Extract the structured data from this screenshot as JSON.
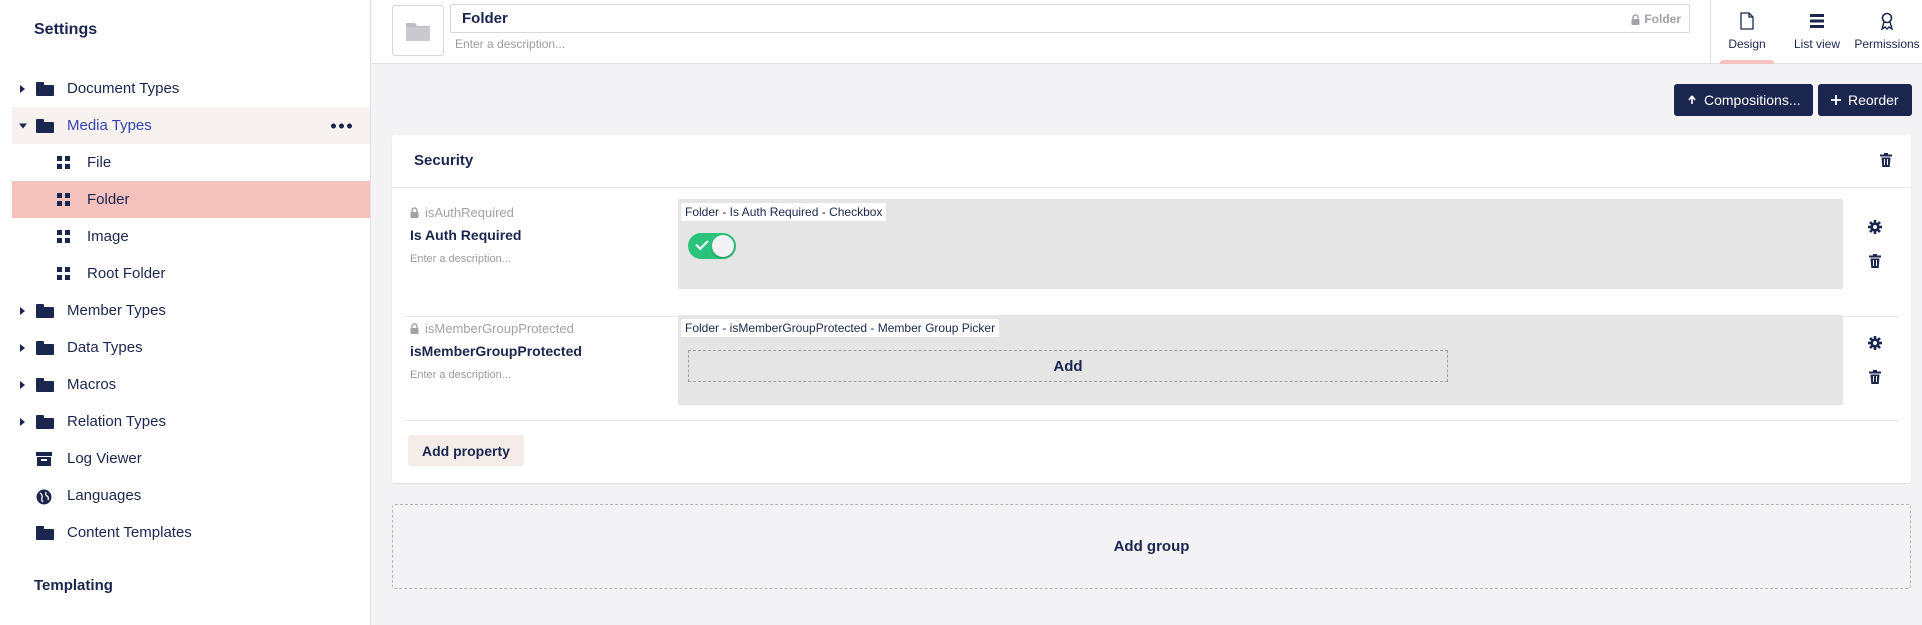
{
  "sidebar": {
    "title": "Settings",
    "items": [
      {
        "label": "Document Types",
        "level": 0,
        "icon": "folder-icon",
        "caret": "closed"
      },
      {
        "label": "Media Types",
        "level": 0,
        "icon": "folder-icon",
        "caret": "open"
      },
      {
        "label": "File",
        "level": 1,
        "icon": "grid-icon"
      },
      {
        "label": "Folder",
        "level": 1,
        "icon": "grid-icon"
      },
      {
        "label": "Image",
        "level": 1,
        "icon": "grid-icon"
      },
      {
        "label": "Root Folder",
        "level": 1,
        "icon": "grid-icon"
      },
      {
        "label": "Member Types",
        "level": 0,
        "icon": "folder-icon",
        "caret": "closed"
      },
      {
        "label": "Data Types",
        "level": 0,
        "icon": "folder-icon",
        "caret": "closed"
      },
      {
        "label": "Macros",
        "level": 0,
        "icon": "folder-icon",
        "caret": "closed"
      },
      {
        "label": "Relation Types",
        "level": 0,
        "icon": "folder-icon",
        "caret": "closed"
      },
      {
        "label": "Log Viewer",
        "level": 0,
        "icon": "archive-icon"
      },
      {
        "label": "Languages",
        "level": 0,
        "icon": "globe-icon"
      },
      {
        "label": "Content Templates",
        "level": 0,
        "icon": "folder-icon"
      }
    ],
    "section2_title": "Templating"
  },
  "header": {
    "name_value": "Folder",
    "alias": "Folder",
    "description_placeholder": "Enter a description...",
    "tabs": [
      {
        "label": "Design",
        "icon": "document-icon"
      },
      {
        "label": "List view",
        "icon": "list-icon"
      },
      {
        "label": "Permissions",
        "icon": "permissions-icon"
      }
    ]
  },
  "toolbar": {
    "compositions_label": "Compositions...",
    "reorder_label": "Reorder"
  },
  "group": {
    "title": "Security",
    "properties": [
      {
        "alias": "isAuthRequired",
        "name": "Is Auth Required",
        "description": "Enter a description...",
        "editor_tag": "Folder - Is Auth Required - Checkbox",
        "toggle_on": true
      },
      {
        "alias": "isMemberGroupProtected",
        "name": "isMemberGroupProtected",
        "description": "Enter a description...",
        "editor_tag": "Folder - isMemberGroupProtected - Member Group Picker",
        "add_label": "Add"
      }
    ],
    "add_property_label": "Add property"
  },
  "add_group_label": "Add group",
  "colors": {
    "primary": "#1b264f",
    "selected": "#f5c1bc",
    "toggle": "#2bc37c",
    "accent_text": "#3544b1"
  }
}
